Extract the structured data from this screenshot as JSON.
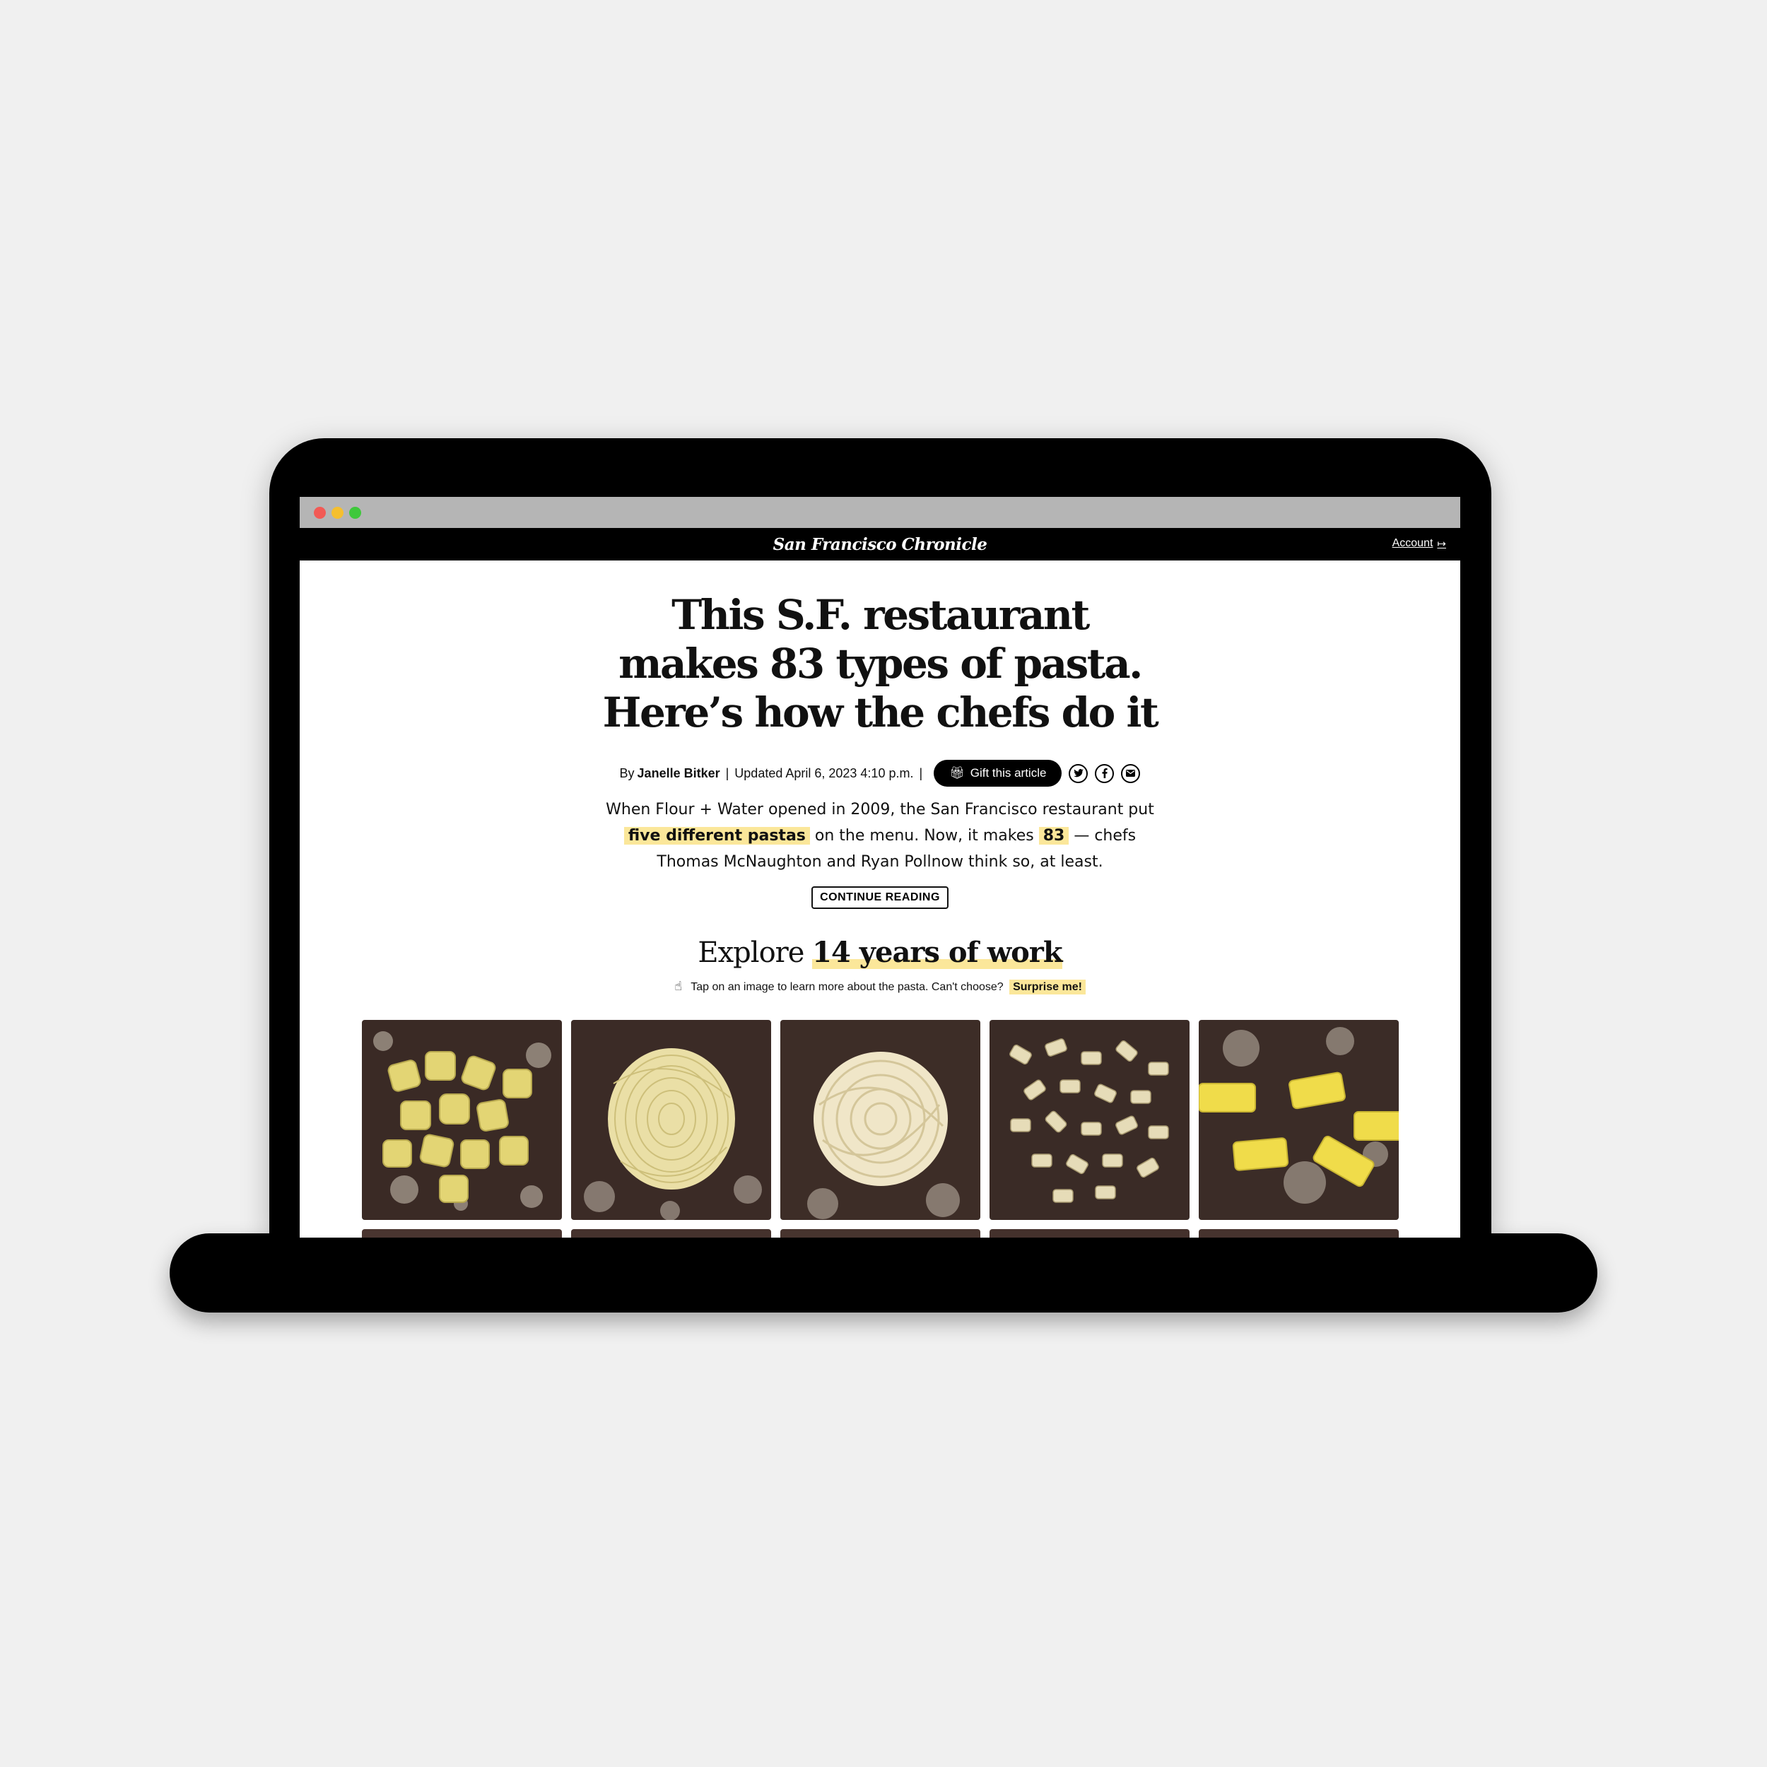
{
  "site": {
    "name": "San Francisco Chronicle",
    "account_label": "Account"
  },
  "article": {
    "headline": "This S.F. restaurant makes 83 types of pasta. Here’s how the chefs do it",
    "by_prefix": "By",
    "author": "Janelle Bitker",
    "updated": "Updated April 6, 2023 4:10 p.m.",
    "gift_label": "Gift this article",
    "dek": {
      "part1": "When Flour + Water opened in 2009, the San Francisco restaurant put",
      "hl1": "five different pastas",
      "part2": "on the menu. Now, it makes",
      "hl2": "83",
      "part3": "— chefs Thomas McNaughton and Ryan Pollnow think so, at least."
    },
    "continue_label": "CONTINUE READING"
  },
  "explore": {
    "prefix": "Explore",
    "highlight": "14 years of work",
    "hint": "Tap on an image to learn more about the pasta. Can't choose?",
    "surprise_label": "Surprise me!"
  },
  "colors": {
    "highlight": "#fbe79a",
    "board": "#3e2c25",
    "pasta_yellow": "#e6d776"
  },
  "icons": {
    "account": "logout-icon",
    "gift": "gift-icon",
    "twitter": "twitter-icon",
    "facebook": "facebook-icon",
    "email": "email-icon",
    "tap": "hand-pointer-icon"
  }
}
